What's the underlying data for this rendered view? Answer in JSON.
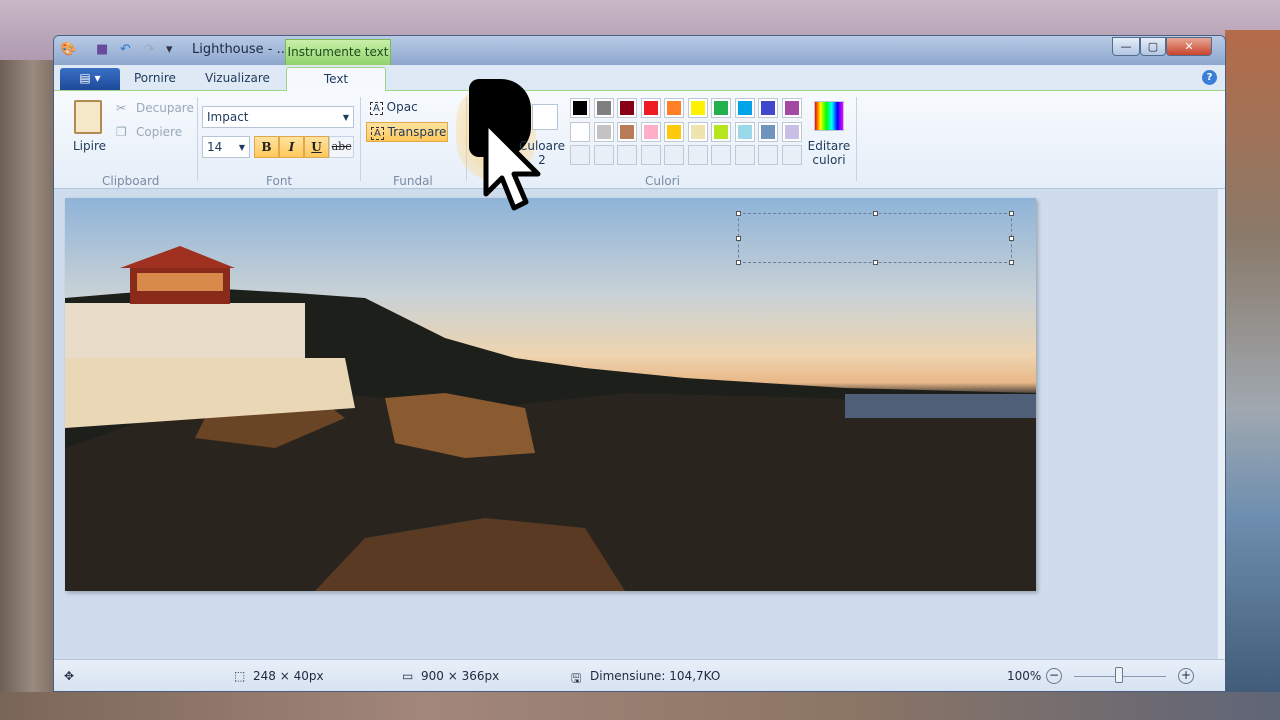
{
  "window": {
    "title": "Lighthouse - ...",
    "context_tab": "Instrumente text",
    "minimize": "—",
    "maximize": "▢",
    "close": "✕"
  },
  "quick_access": {
    "app_icon": "paint-palette-icon",
    "save_icon": "save-icon",
    "undo_icon": "undo-icon",
    "redo_icon": "redo-icon",
    "customize": "▾"
  },
  "tabs": [
    {
      "label": "Pornire"
    },
    {
      "label": "Vizualizare"
    },
    {
      "label": "Text",
      "active": true
    }
  ],
  "file_menu": "▤ ▾",
  "help": "?",
  "clipboard": {
    "paste": "Lipire",
    "cut": "Decupare",
    "copy": "Copiere",
    "group": "Clipboard"
  },
  "font": {
    "family": "Impact",
    "size": "14",
    "bold": "B",
    "italic": "I",
    "underline": "U",
    "strike": "abc",
    "group": "Font"
  },
  "background": {
    "opaque": "Opac",
    "transparent": "Transparent",
    "group": "Fundal"
  },
  "colors": {
    "color2": "Culoare 2",
    "edit": "Editare culori",
    "group": "Culori",
    "row1": [
      "#000000",
      "#7f7f7f",
      "#880015",
      "#ed1c24",
      "#ff7f27",
      "#fff200",
      "#22b14c",
      "#00a2e8",
      "#3f48cc",
      "#a349a4"
    ],
    "row2": [
      "#ffffff",
      "#c3c3c3",
      "#b97a57",
      "#ffaec9",
      "#ffc90e",
      "#efe4b0",
      "#b5e61d",
      "#99d9ea",
      "#7092be",
      "#c8bfe7"
    ],
    "color1": "#000000",
    "color2_value": "#ffffff"
  },
  "status": {
    "selection": "248 × 40px",
    "image_size": "900 × 366px",
    "file_size": "Dimensiune: 104,7KO",
    "zoom": "100%",
    "zoom_level_percent": 100
  }
}
